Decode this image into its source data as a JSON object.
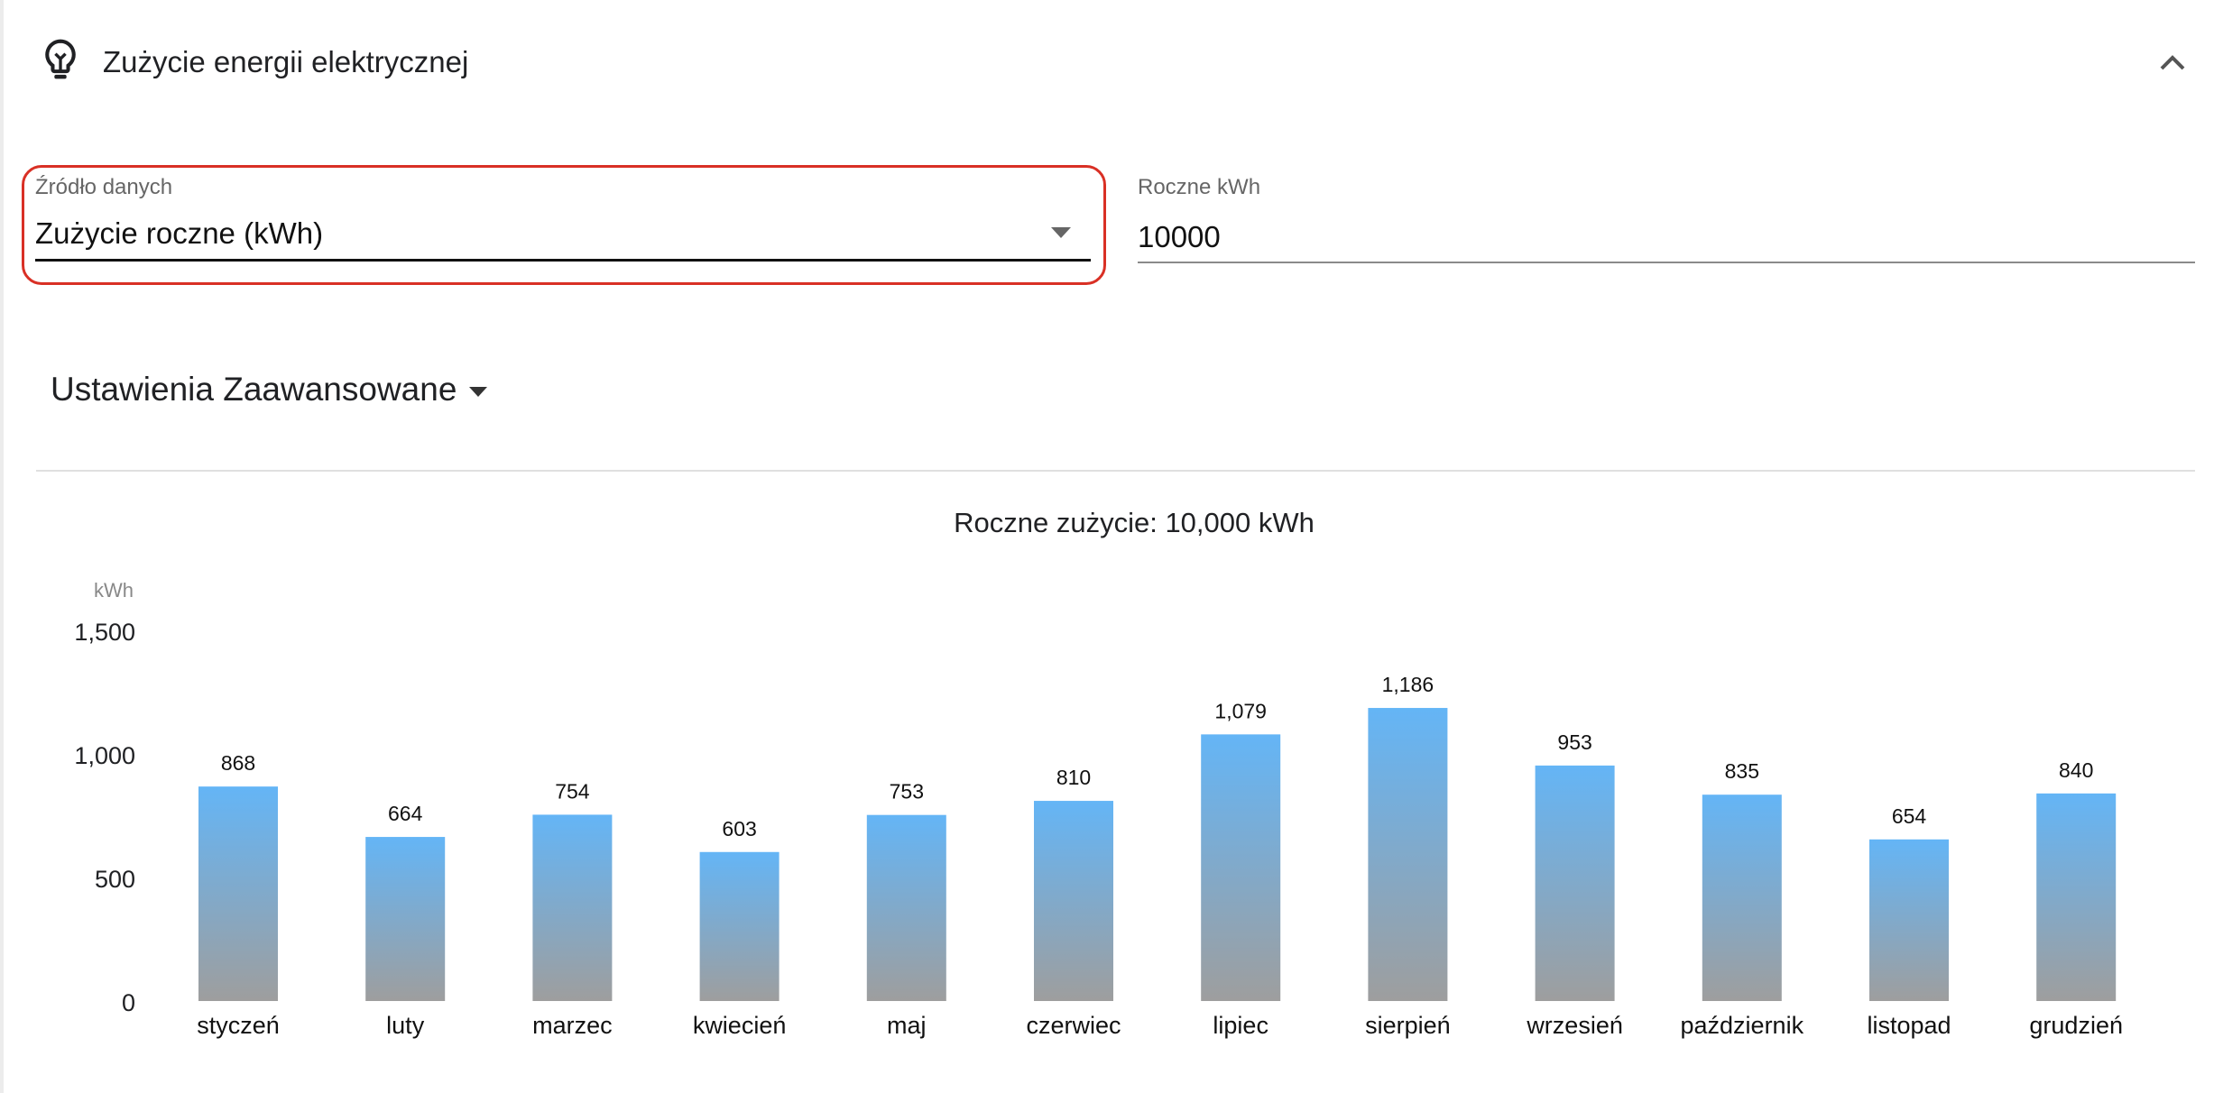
{
  "header": {
    "title": "Zużycie energii elektrycznej",
    "icon": "lightbulb-icon",
    "collapse_icon": "chevron-up-icon"
  },
  "source_select": {
    "label": "Źródło danych",
    "value": "Zużycie roczne (kWh)"
  },
  "annual_input": {
    "label": "Roczne kWh",
    "value": "10000"
  },
  "advanced": {
    "label": "Ustawienia Zaawansowane"
  },
  "chart_data": {
    "type": "bar",
    "title": "Roczne zużycie: 10,000 kWh",
    "ylabel": "kWh",
    "ylim": [
      0,
      1500
    ],
    "yticks": [
      "1,500",
      "1,000",
      "500",
      "0"
    ],
    "categories": [
      "styczeń",
      "luty",
      "marzec",
      "kwiecień",
      "maj",
      "czerwiec",
      "lipiec",
      "sierpień",
      "wrzesień",
      "październik",
      "listopad",
      "grudzień"
    ],
    "values": [
      868,
      664,
      754,
      603,
      753,
      810,
      1079,
      1186,
      953,
      835,
      654,
      840
    ],
    "value_labels": [
      "868",
      "664",
      "754",
      "603",
      "753",
      "810",
      "1,079",
      "1,186",
      "953",
      "835",
      "654",
      "840"
    ],
    "grid": false,
    "bar_gradient_top": "#64b5f6",
    "bar_gradient_bottom": "#9e9e9e"
  }
}
